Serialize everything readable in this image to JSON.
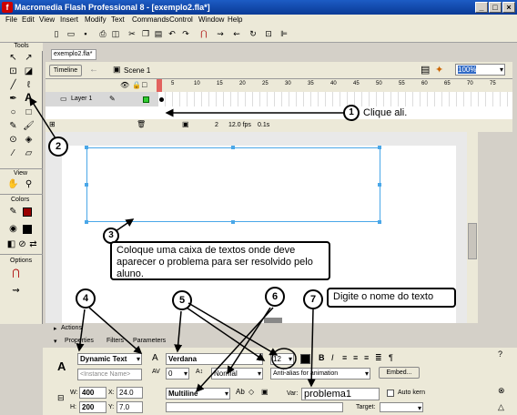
{
  "window": {
    "title": "Macromedia Flash Professional 8 - [exemplo2.fla*]"
  },
  "menu": [
    "File",
    "Edit",
    "View",
    "Insert",
    "Modify",
    "Text",
    "Commands",
    "Control",
    "Window",
    "Help"
  ],
  "tools": {
    "header": "Tools",
    "view_label": "View",
    "colors_label": "Colors",
    "options_label": "Options"
  },
  "document": {
    "tab": "exemplo2.fla*",
    "timeline_label": "Timeline",
    "scene_label": "Scene 1",
    "zoom": "100%"
  },
  "timeline": {
    "layer_name": "Layer 1",
    "frame_number": "2",
    "fps": "12.0 fps",
    "time": "0.1s",
    "ruler": [
      "5",
      "10",
      "15",
      "20",
      "25",
      "30",
      "35",
      "40",
      "45",
      "50",
      "55",
      "60",
      "65",
      "70",
      "75"
    ]
  },
  "callouts": {
    "c1": {
      "num": "1",
      "text": "Clique ali."
    },
    "c2": {
      "num": "2"
    },
    "c3": {
      "num": "3",
      "text": "Coloque uma caixa de textos onde deve aparecer o problema para ser resolvido pelo aluno."
    },
    "c4": {
      "num": "4"
    },
    "c5": {
      "num": "5"
    },
    "c6": {
      "num": "6"
    },
    "c7": {
      "num": "7",
      "text": "Digite o nome do texto"
    }
  },
  "panels": {
    "actions": "Actions",
    "properties_tab": "Properties",
    "filters_tab": "Filters",
    "parameters_tab": "Parameters"
  },
  "properties": {
    "text_type": "Dynamic Text",
    "instance_name_placeholder": "<Instance Name>",
    "font": "Verdana",
    "font_size": "12",
    "letter_spacing": "0",
    "position": "Normal",
    "anti_alias": "Anti-alias for animation",
    "embed_button": "Embed...",
    "w_label": "W:",
    "w": "400",
    "h_label": "H:",
    "h": "200",
    "x_label": "X:",
    "x": "24.0",
    "y_label": "Y:",
    "y": "7.0",
    "line_type": "Multiline",
    "var_label": "Var:",
    "var": "problema1",
    "auto_kern": "Auto kern",
    "target_label": "Target:"
  },
  "colors": {
    "title_bar": "#0a3a96",
    "textbox_outline": "#4aa7e8",
    "playhead": "#e04040"
  }
}
